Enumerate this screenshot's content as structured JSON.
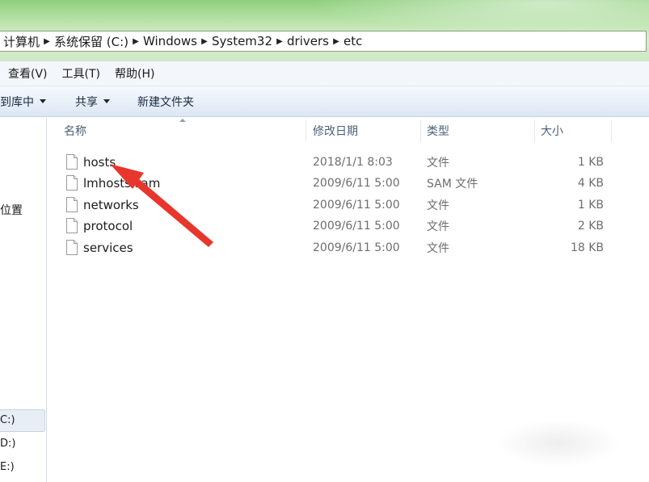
{
  "address": {
    "crumbs": [
      "计算机",
      "系统保留 (C:)",
      "Windows",
      "System32",
      "drivers",
      "etc"
    ]
  },
  "menu": {
    "items": [
      "查看(V)",
      "工具(T)",
      "帮助(H)"
    ]
  },
  "commands": {
    "include_in_library": "到库中",
    "share": "共享",
    "new_folder": "新建文件夹"
  },
  "nav": {
    "location": "位置",
    "drive_c": "C:)",
    "drive_d": "D:)",
    "drive_e": "E:)"
  },
  "columns": {
    "name": "名称",
    "date": "修改日期",
    "type": "类型",
    "size": "大小"
  },
  "files": [
    {
      "name": "hosts",
      "date": "2018/1/1 8:03",
      "type": "文件",
      "size": "1 KB"
    },
    {
      "name": "lmhosts.sam",
      "date": "2009/6/11 5:00",
      "type": "SAM 文件",
      "size": "4 KB"
    },
    {
      "name": "networks",
      "date": "2009/6/11 5:00",
      "type": "文件",
      "size": "1 KB"
    },
    {
      "name": "protocol",
      "date": "2009/6/11 5:00",
      "type": "文件",
      "size": "2 KB"
    },
    {
      "name": "services",
      "date": "2009/6/11 5:00",
      "type": "文件",
      "size": "18 KB"
    }
  ],
  "colors": {
    "annotation_arrow": "#e8362c",
    "aero_green": "#b4e0a4",
    "header_text": "#4c607a"
  },
  "icons": {
    "breadcrumb_separator": "chevron-right-icon",
    "file": "document-icon",
    "dropdown": "caret-down-icon",
    "annotation": "red-arrow"
  }
}
